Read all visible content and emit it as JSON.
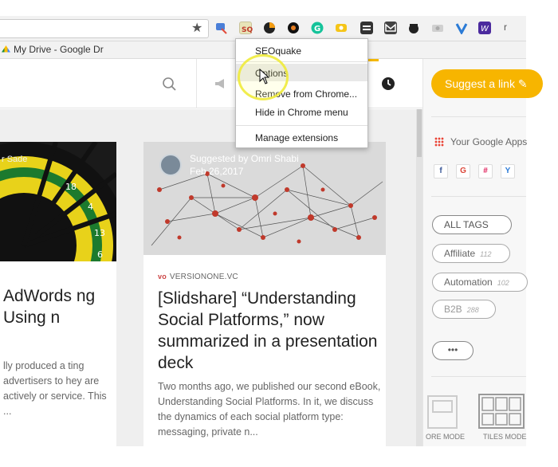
{
  "browser": {
    "bookmark_label": "My Drive - Google Dr",
    "star_icon": "★"
  },
  "extensions_menu": {
    "items": [
      "SEOquake",
      "Options",
      "Remove from Chrome...",
      "Hide in Chrome menu",
      "Manage extensions"
    ]
  },
  "header": {
    "search_icon": "search-icon",
    "clock_icon": "clock-icon"
  },
  "cards": {
    "left": {
      "suggester": "r Sade",
      "title": "AdWords ng Using n",
      "excerpt": "lly produced a ting advertisers to hey are actively or service. This ..."
    },
    "right": {
      "suggested_by": "Suggested by Omri Shabi",
      "date": "Feb 26,2017",
      "source_icon": "vo",
      "source": "VERSIONONE.VC",
      "title": "[Slidshare] “Understanding Social Platforms,” now summarized in a presentation deck",
      "excerpt": "Two months ago, we published our second eBook, Understanding Social Platforms. In it, we discuss the dynamics of each social platform type: messaging, private n..."
    }
  },
  "sidebar": {
    "suggest_label": "Suggest a link",
    "google_apps_label": "Your Google Apps",
    "tags": [
      {
        "label": "ALL TAGS",
        "count": ""
      },
      {
        "label": "Affiliate",
        "count": "112"
      },
      {
        "label": "Automation",
        "count": "102"
      },
      {
        "label": "B2B",
        "count": "288"
      }
    ],
    "more_label": "•••",
    "modes": [
      "ORE MODE",
      "TILES MODE"
    ]
  },
  "colors": {
    "accent": "#f7b500",
    "menu_highlight": "#e8e8e8",
    "cursor_halo": "#f0eb3c"
  }
}
